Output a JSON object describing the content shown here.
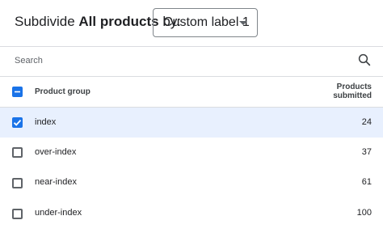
{
  "header": {
    "prefix": "Subdivide",
    "bold": "All products",
    "suffix": "by:",
    "dropdown_value": "Custom label 1"
  },
  "search": {
    "placeholder": "Search"
  },
  "table": {
    "column_product_group": "Product group",
    "column_submitted_line1": "Products",
    "column_submitted_line2": "submitted",
    "rows": [
      {
        "label": "index",
        "value": "24",
        "checked": true
      },
      {
        "label": "over-index",
        "value": "37",
        "checked": false
      },
      {
        "label": "near-index",
        "value": "61",
        "checked": false
      },
      {
        "label": "under-index",
        "value": "100",
        "checked": false
      }
    ]
  },
  "colors": {
    "accent": "#1a73e8",
    "selected_row": "#e8f0fe"
  },
  "icons": {
    "search": "search-icon",
    "dropdown": "caret-down-icon",
    "header_checkbox": "indeterminate-checkbox-icon",
    "row_checkbox": "checkbox-icon"
  }
}
